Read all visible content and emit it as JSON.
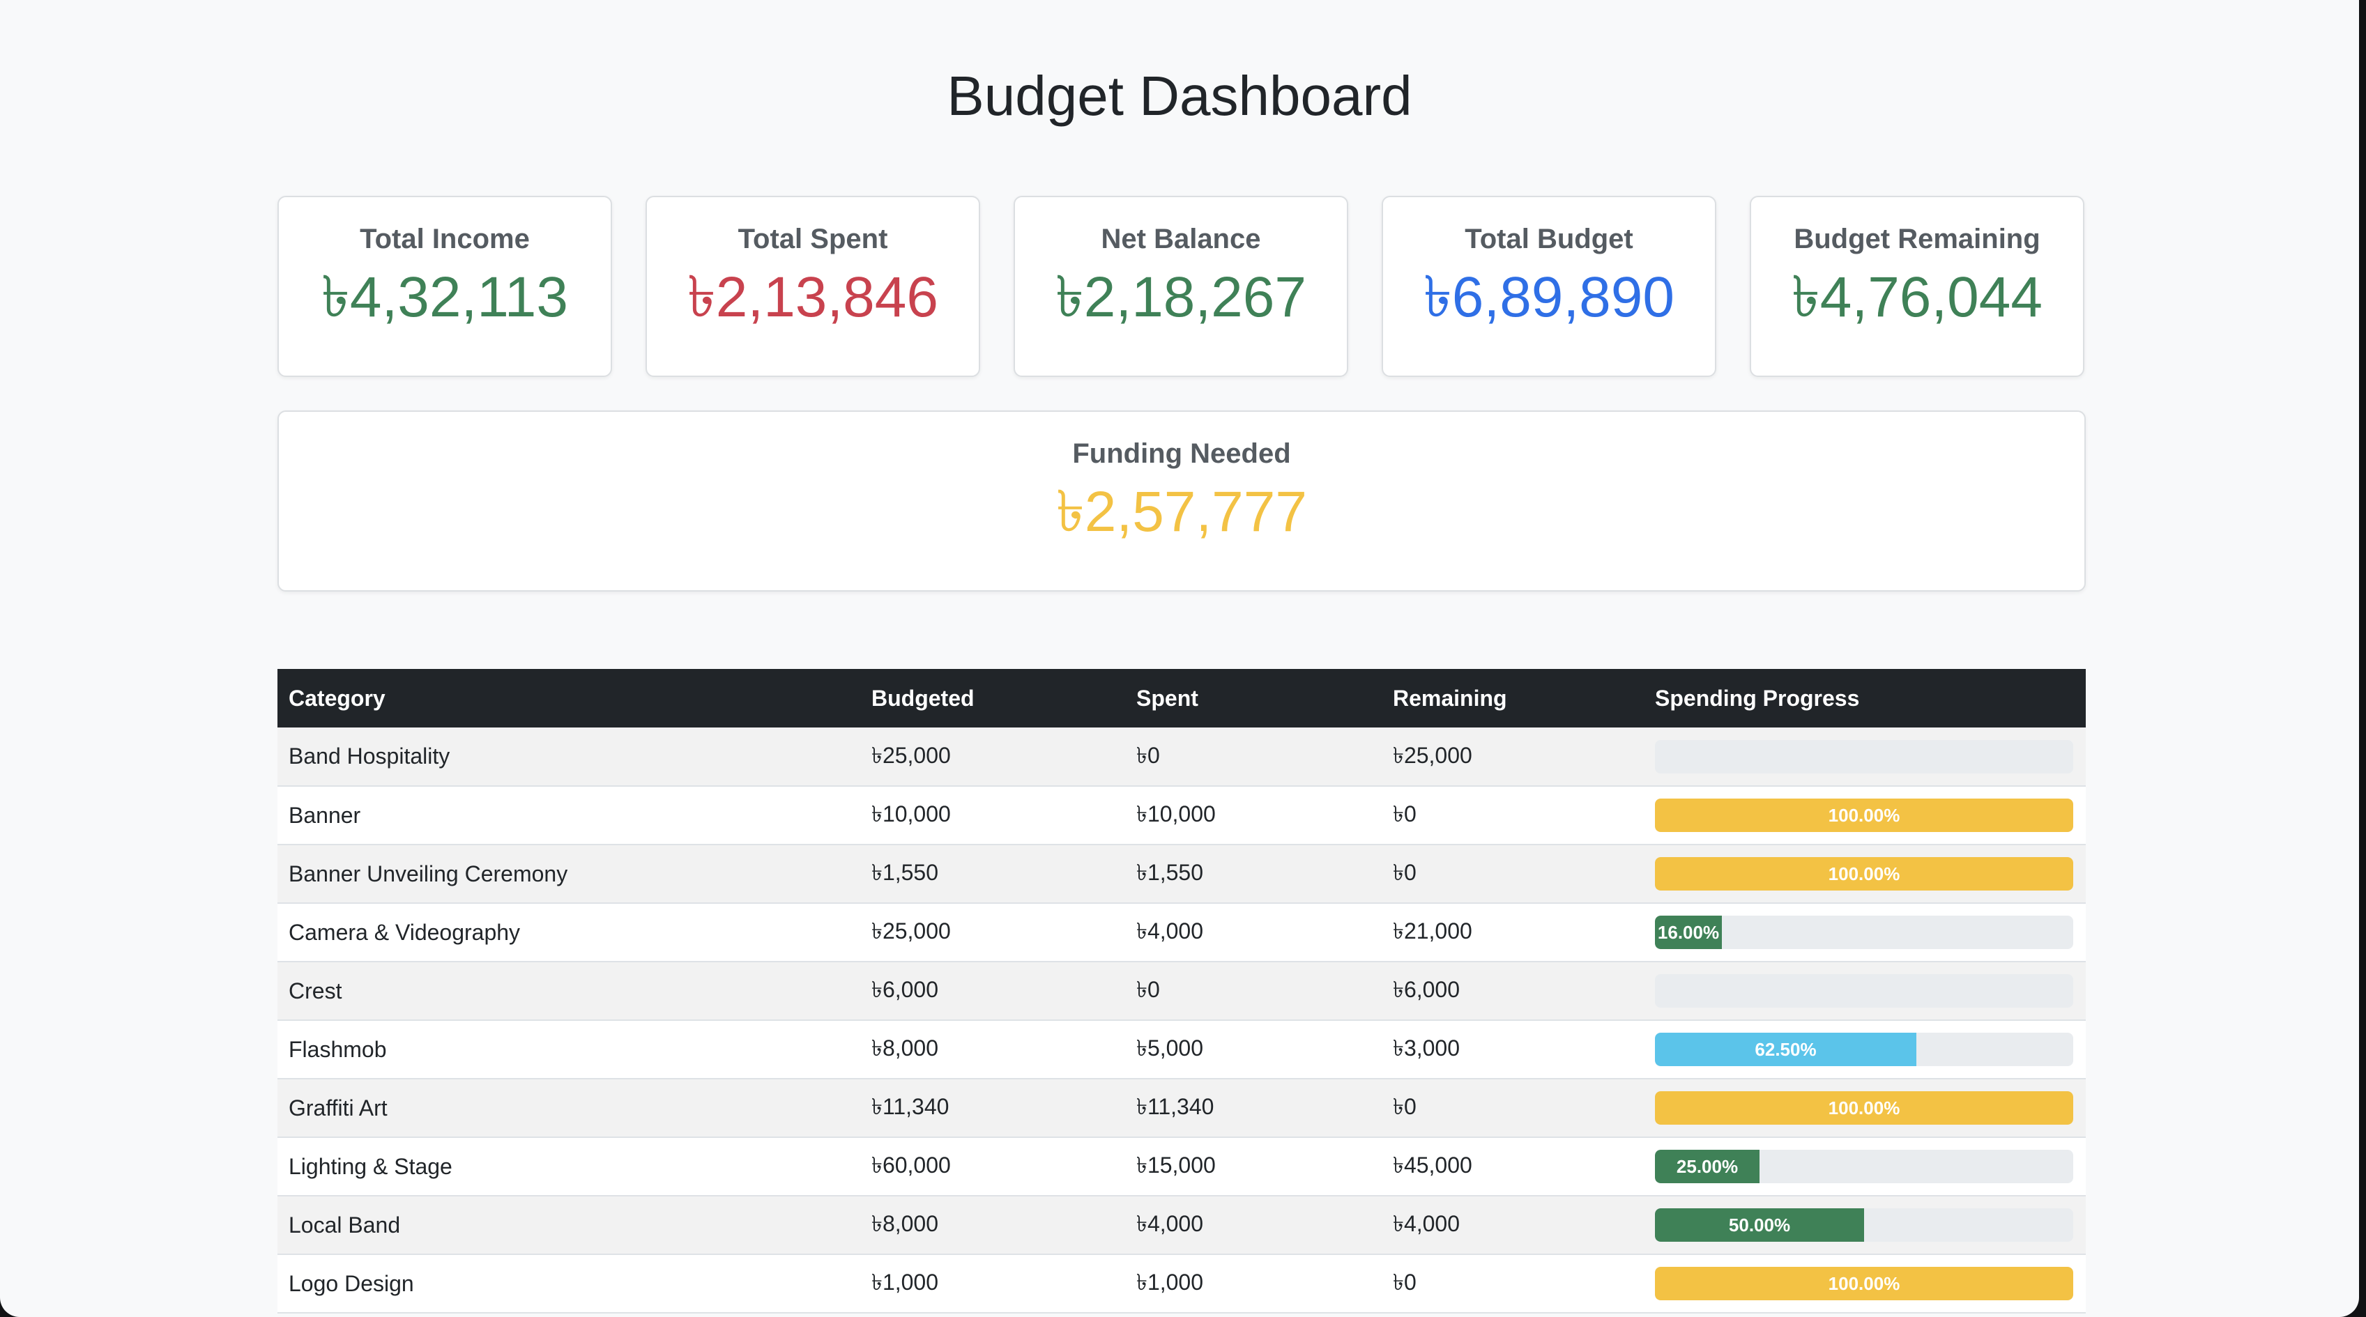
{
  "title": "Budget Dashboard",
  "colors": {
    "green": "#3f8157",
    "red": "#c8424e",
    "blue": "#2f6fe6",
    "yellow": "#f3c244",
    "info": "#5bc4ea",
    "success": "#3f8157",
    "warning": "#f3c244"
  },
  "summary": {
    "total_income": {
      "label": "Total Income",
      "value": "৳4,32,113"
    },
    "total_spent": {
      "label": "Total Spent",
      "value": "৳2,13,846"
    },
    "net_balance": {
      "label": "Net Balance",
      "value": "৳2,18,267"
    },
    "total_budget": {
      "label": "Total Budget",
      "value": "৳6,89,890"
    },
    "budget_remaining": {
      "label": "Budget Remaining",
      "value": "৳4,76,044"
    },
    "funding_needed": {
      "label": "Funding Needed",
      "value": "৳2,57,777"
    }
  },
  "table": {
    "headers": {
      "category": "Category",
      "budgeted": "Budgeted",
      "spent": "Spent",
      "remaining": "Remaining",
      "progress": "Spending Progress"
    },
    "rows": [
      {
        "category": "Band Hospitality",
        "budgeted": "৳25,000",
        "spent": "৳0",
        "remaining": "৳25,000",
        "progress_percent": 0,
        "progress_label": "",
        "bar_color": "#f3c244"
      },
      {
        "category": "Banner",
        "budgeted": "৳10,000",
        "spent": "৳10,000",
        "remaining": "৳0",
        "progress_percent": 100,
        "progress_label": "100.00%",
        "bar_color": "#f3c244"
      },
      {
        "category": "Banner Unveiling Ceremony",
        "budgeted": "৳1,550",
        "spent": "৳1,550",
        "remaining": "৳0",
        "progress_percent": 100,
        "progress_label": "100.00%",
        "bar_color": "#f3c244"
      },
      {
        "category": "Camera & Videography",
        "budgeted": "৳25,000",
        "spent": "৳4,000",
        "remaining": "৳21,000",
        "progress_percent": 16,
        "progress_label": "16.00%",
        "bar_color": "#3f8157"
      },
      {
        "category": "Crest",
        "budgeted": "৳6,000",
        "spent": "৳0",
        "remaining": "৳6,000",
        "progress_percent": 0,
        "progress_label": "",
        "bar_color": "#3f8157"
      },
      {
        "category": "Flashmob",
        "budgeted": "৳8,000",
        "spent": "৳5,000",
        "remaining": "৳3,000",
        "progress_percent": 62.5,
        "progress_label": "62.50%",
        "bar_color": "#5bc4ea"
      },
      {
        "category": "Graffiti Art",
        "budgeted": "৳11,340",
        "spent": "৳11,340",
        "remaining": "৳0",
        "progress_percent": 100,
        "progress_label": "100.00%",
        "bar_color": "#f3c244"
      },
      {
        "category": "Lighting & Stage",
        "budgeted": "৳60,000",
        "spent": "৳15,000",
        "remaining": "৳45,000",
        "progress_percent": 25,
        "progress_label": "25.00%",
        "bar_color": "#3f8157"
      },
      {
        "category": "Local Band",
        "budgeted": "৳8,000",
        "spent": "৳4,000",
        "remaining": "৳4,000",
        "progress_percent": 50,
        "progress_label": "50.00%",
        "bar_color": "#3f8157"
      },
      {
        "category": "Logo Design",
        "budgeted": "৳1,000",
        "spent": "৳1,000",
        "remaining": "৳0",
        "progress_percent": 100,
        "progress_label": "100.00%",
        "bar_color": "#f3c244"
      }
    ]
  }
}
